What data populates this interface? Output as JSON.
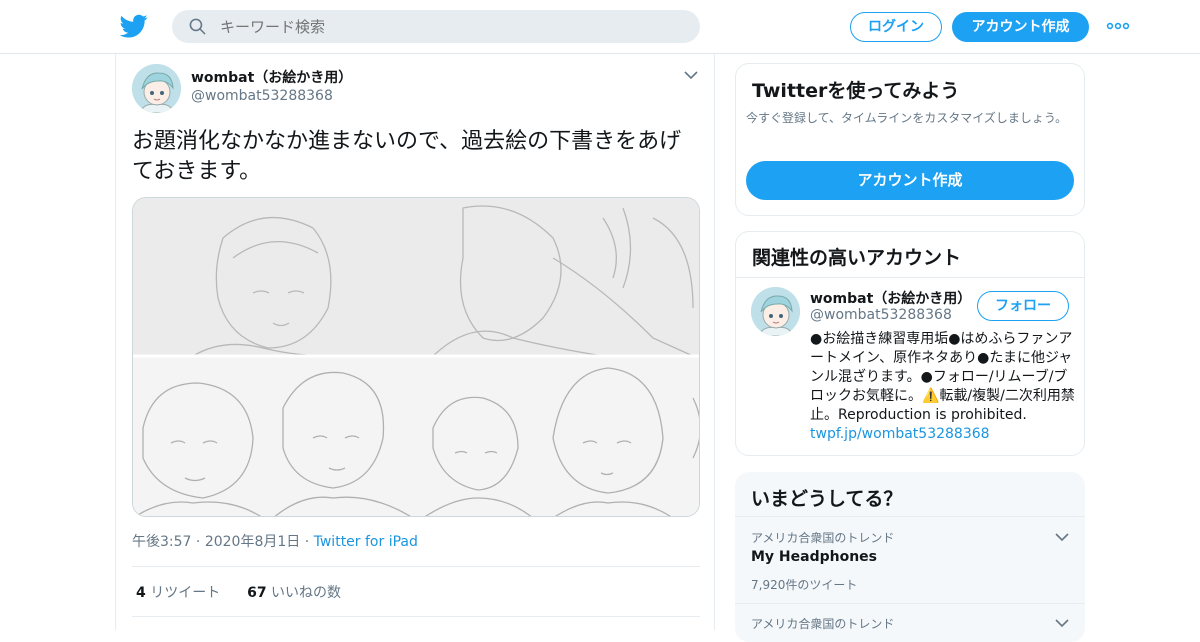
{
  "header": {
    "search_placeholder": "キーワード検索",
    "login_label": "ログイン",
    "signup_label": "アカウント作成"
  },
  "tweet": {
    "author_name": "wombat（お絵かき用）",
    "author_handle": "@wombat53288368",
    "text": "お題消化なかなか進まないので、過去絵の下書きをあげておきます。",
    "time": "午後3:57",
    "date": "2020年8月1日",
    "source": "Twitter for iPad",
    "retweet_count": "4",
    "retweet_label": "リツイート",
    "like_count": "67",
    "like_label": "いいねの数"
  },
  "signup_card": {
    "title": "Twitterを使ってみよう",
    "subtitle": "今すぐ登録して、タイムラインをカスタマイズしましょう。",
    "button_label": "アカウント作成"
  },
  "related": {
    "title": "関連性の高いアカウント",
    "name": "wombat（お絵かき用）",
    "handle": "@wombat53288368",
    "follow_label": "フォロー",
    "bio": "●お絵描き練習専用垢●はめふらファンアートメイン、原作ネタあり●たまに他ジャンル混ざります。●フォロー/リムーブ/ブロックお気軽に。⚠️転載/複製/二次利用禁止。Reproduction is prohibited. ",
    "bio_link": "twpf.jp/wombat53288368"
  },
  "trends": {
    "title": "いまどうしてる？",
    "items": [
      {
        "category": "アメリカ合衆国のトレンド",
        "name": "My Headphones",
        "count": "7,920件のツイート"
      },
      {
        "category": "アメリカ合衆国のトレンド",
        "name": "",
        "count": ""
      }
    ]
  },
  "colors": {
    "accent": "#1da1f2",
    "link": "#1b95e0",
    "muted": "#657786"
  },
  "icons": [
    "twitter-bird-icon",
    "search-icon",
    "more-icon",
    "chevron-down-icon"
  ]
}
